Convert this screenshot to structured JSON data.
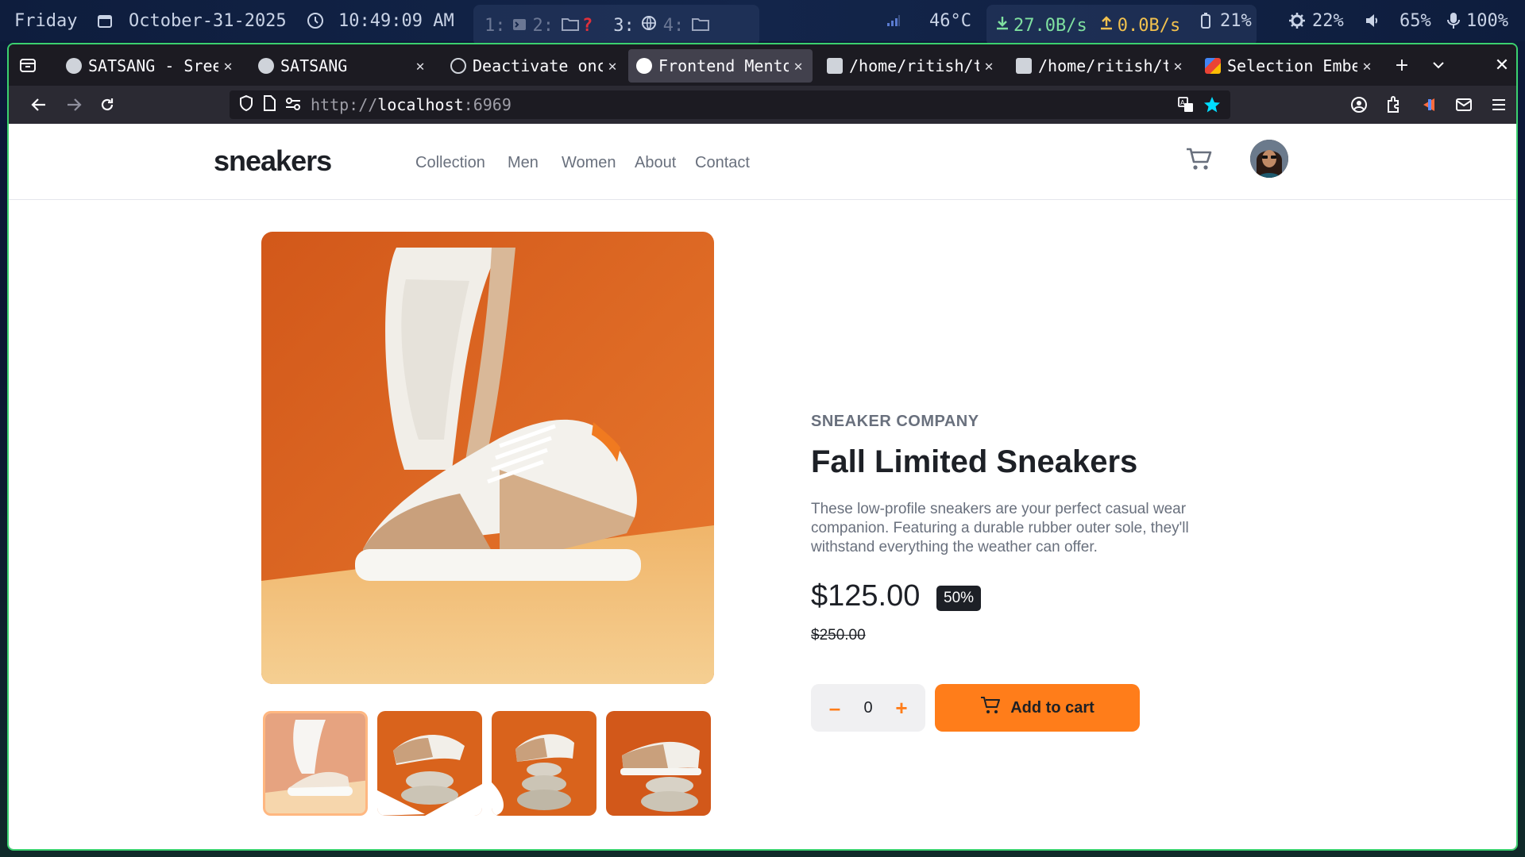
{
  "statusbar": {
    "day": "Friday",
    "date": "October-31-2025",
    "time": "10:49:09 AM",
    "workspaces": [
      "1:",
      "2:",
      "3:",
      "4:"
    ],
    "temperature": "46°C",
    "download": "27.0B/s",
    "upload": "0.0B/s",
    "battery": "21%",
    "cpu": "22%",
    "volume": "65%",
    "mic": "100%"
  },
  "browser": {
    "tabs": [
      {
        "title": "SATSANG - Sree",
        "active": false,
        "favicon_color": "#cfd3da"
      },
      {
        "title": "SATSANG",
        "active": false,
        "favicon_color": "#cfd3da"
      },
      {
        "title": "Deactivate onc",
        "active": false,
        "favicon_color": "#cfd3da"
      },
      {
        "title": "Frontend Mento",
        "active": true,
        "favicon_color": "#ffffff"
      },
      {
        "title": "/home/ritish/t",
        "active": false,
        "favicon_color": "#cfd3da"
      },
      {
        "title": "/home/ritish/t",
        "active": false,
        "favicon_color": "#cfd3da"
      },
      {
        "title": "Selection Embe",
        "active": false,
        "favicon_color": "#4285f4"
      }
    ],
    "url_scheme": "http://",
    "url_host": "localhost",
    "url_port": ":6969"
  },
  "site": {
    "logo": "sneakers",
    "nav": [
      "Collection",
      "Men",
      "Women",
      "About",
      "Contact"
    ]
  },
  "product": {
    "company": "SNEAKER COMPANY",
    "title": "Fall Limited Sneakers",
    "description": "These low-profile sneakers are your perfect casual wear companion. Featuring a durable rubber outer sole, they'll withstand everything the weather can offer.",
    "price": "$125.00",
    "discount": "50%",
    "original_price": "$250.00",
    "quantity": "0",
    "minus": "–",
    "plus": "+",
    "add_to_cart": "Add to cart",
    "thumbnail_count": 4,
    "active_thumbnail": 1
  },
  "colors": {
    "accent": "#ff7d1a",
    "window_border": "#3bd16f",
    "dark_text": "#1d2026",
    "muted_text": "#69707d"
  }
}
